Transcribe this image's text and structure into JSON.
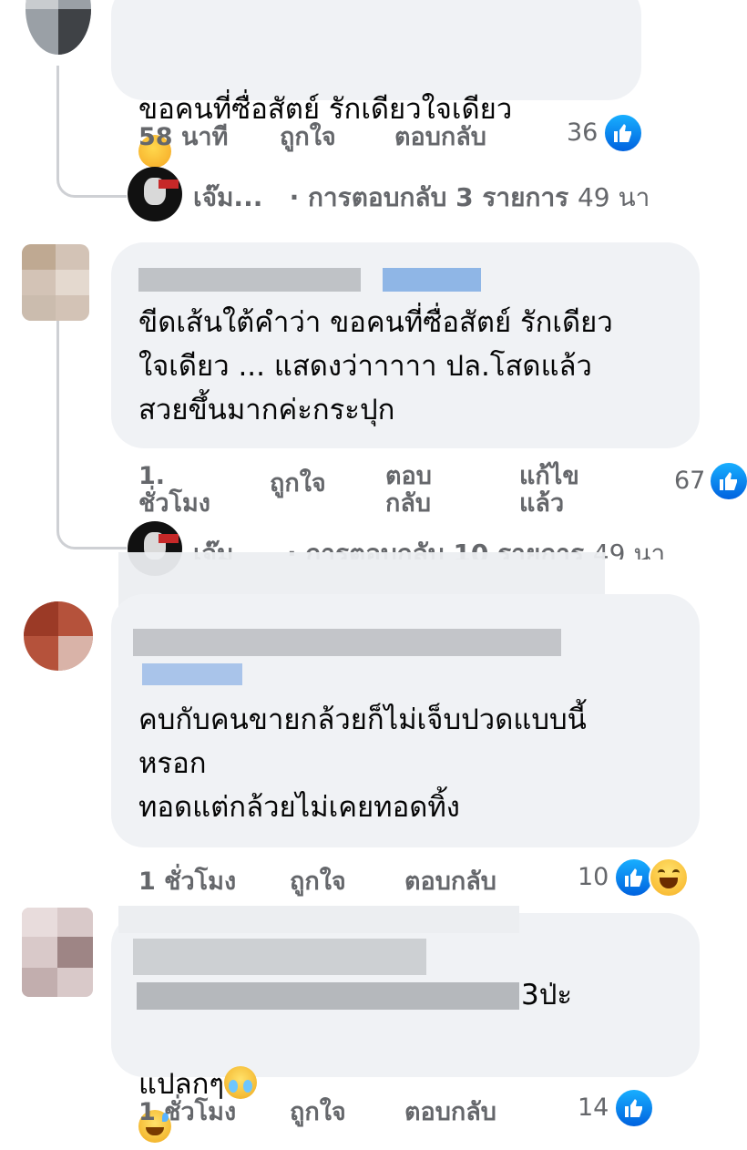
{
  "comments": [
    {
      "text": "ขอคนที่ซื่อสัตย์ รักเดียวใจเดียว",
      "time": "58 นาที",
      "like_label": "ถูกใจ",
      "reply_label": "ตอบกลับ",
      "reaction_count": "36",
      "replies": {
        "name": "เจ๊ม...",
        "label": "· การตอบกลับ 3 รายการ",
        "time": "49 นา"
      }
    },
    {
      "text": "ขีดเส้นใต้คำว่า ขอคนที่ซื่อสัตย์ รักเดียว\nใจเดียว ... แสดงว่าาาาา ปล.โสดแล้ว\nสวยขึ้นมากค่ะกระปุก",
      "time": "1.\nชั่วโมง",
      "like_label": "ถูกใจ",
      "reply_label": "ตอบ\nกลับ",
      "edited_label": "แก้ไข\nแล้ว",
      "reaction_count": "67",
      "replies": {
        "name": "เจ๊ม",
        "label": "· การตอบกลับ 10 รายการ",
        "time": "49 นา"
      }
    },
    {
      "text": "คบกับคนขายกล้วยก็ไม่เจ็บปวดแบบนี้\nหรอก\nทอดแต่กล้วยไม่เคยทอดทิ้ง",
      "time": "1 ชั่วโมง",
      "like_label": "ถูกใจ",
      "reply_label": "ตอบกลับ",
      "reaction_count": "10"
    },
    {
      "text_line1_end": "3ป่ะ",
      "text_line2": "แปลกๆ",
      "time": "1 ชั่วโมง",
      "like_label": "ถูกใจ",
      "reply_label": "ตอบกลับ",
      "reaction_count": "14"
    }
  ],
  "colors": {
    "bubble": "#f0f2f5",
    "meta": "#65676b",
    "like_blue": "#1877f2"
  },
  "icons": [
    "like-icon",
    "haha-icon",
    "thinking-emoji",
    "sweat-smile-emoji",
    "crying-emoji"
  ]
}
